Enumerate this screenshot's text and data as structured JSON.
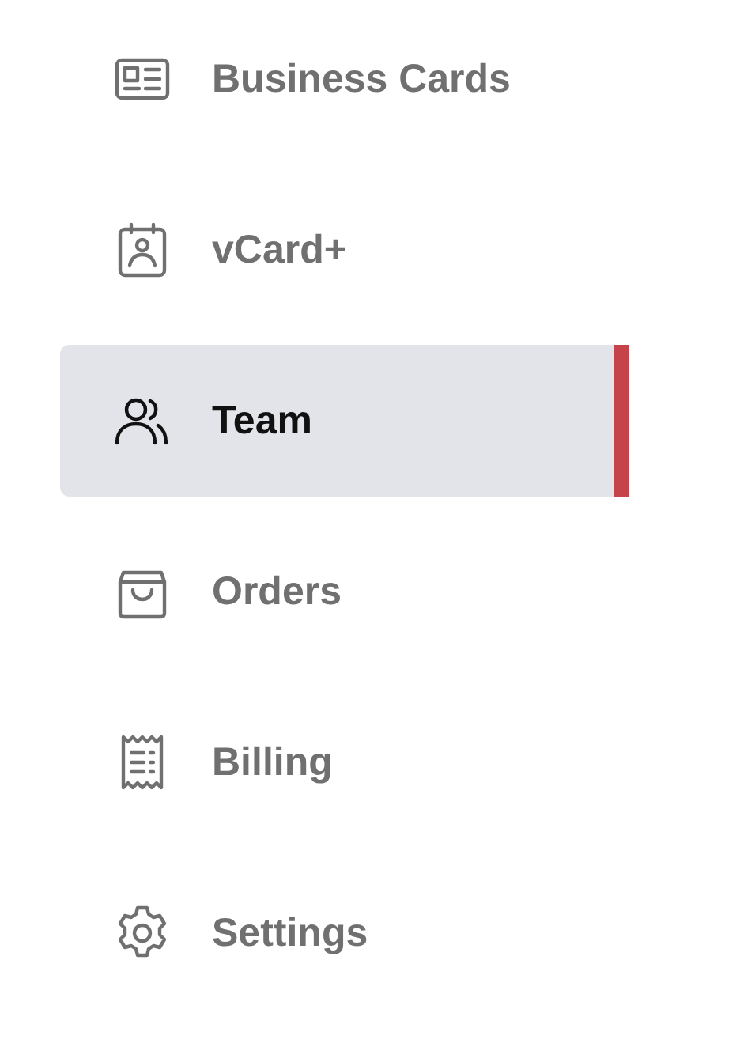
{
  "nav": {
    "items": [
      {
        "label": "Business Cards",
        "kind": "card",
        "selected": false
      },
      {
        "label": "vCard+",
        "kind": "contact",
        "selected": false
      },
      {
        "label": "Team",
        "kind": "team",
        "selected": true
      },
      {
        "label": "Orders",
        "kind": "bag",
        "selected": false
      },
      {
        "label": "Billing",
        "kind": "receipt",
        "selected": false
      },
      {
        "label": "Settings",
        "kind": "gear",
        "selected": false
      }
    ]
  }
}
